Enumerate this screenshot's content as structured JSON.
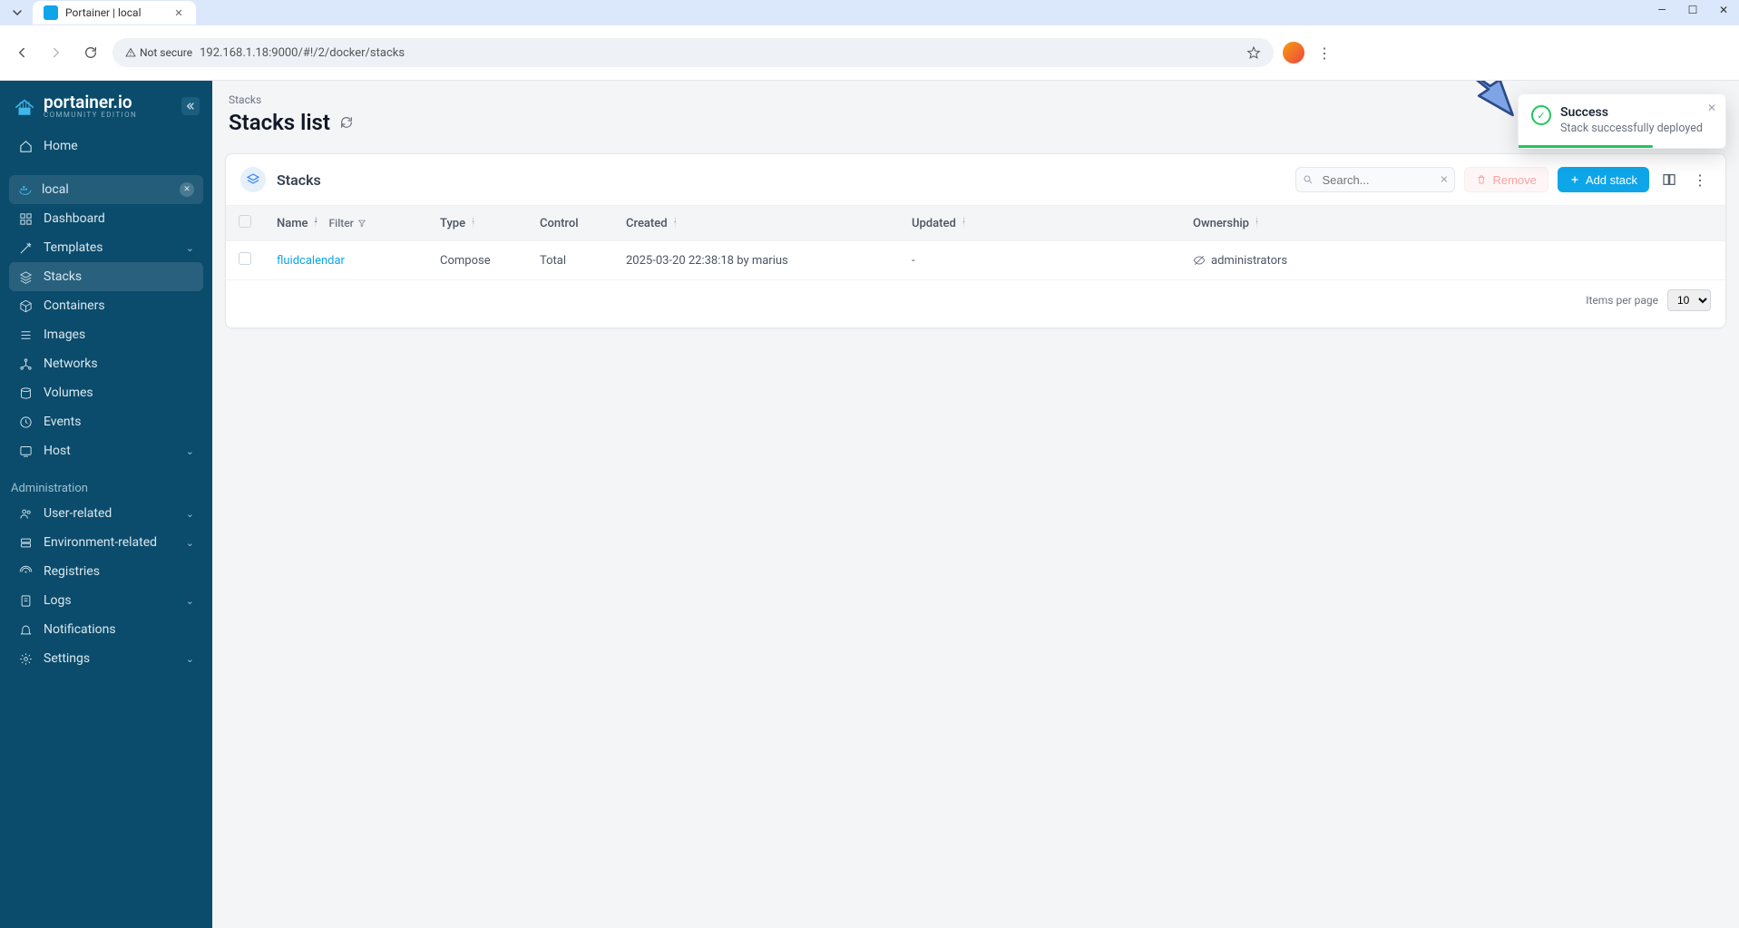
{
  "browser": {
    "tab_title": "Portainer | local",
    "not_secure_label": "Not secure",
    "url": "192.168.1.18:9000/#!/2/docker/stacks"
  },
  "logo": {
    "name": "portainer.io",
    "edition": "COMMUNITY EDITION"
  },
  "sidebar": {
    "home": "Home",
    "env_label": "local",
    "items": [
      {
        "label": "Dashboard"
      },
      {
        "label": "Templates",
        "expandable": true
      },
      {
        "label": "Stacks",
        "active": true
      },
      {
        "label": "Containers"
      },
      {
        "label": "Images"
      },
      {
        "label": "Networks"
      },
      {
        "label": "Volumes"
      },
      {
        "label": "Events"
      },
      {
        "label": "Host",
        "expandable": true
      }
    ],
    "admin_heading": "Administration",
    "admin_items": [
      {
        "label": "User-related",
        "expandable": true
      },
      {
        "label": "Environment-related",
        "expandable": true
      },
      {
        "label": "Registries"
      },
      {
        "label": "Logs",
        "expandable": true
      },
      {
        "label": "Notifications"
      },
      {
        "label": "Settings",
        "expandable": true
      }
    ]
  },
  "page": {
    "breadcrumb": "Stacks",
    "title": "Stacks list"
  },
  "panel": {
    "title": "Stacks",
    "search_placeholder": "Search...",
    "remove_label": "Remove",
    "add_label": "Add stack"
  },
  "table": {
    "columns": {
      "name": "Name",
      "filter": "Filter",
      "type": "Type",
      "control": "Control",
      "created": "Created",
      "updated": "Updated",
      "ownership": "Ownership"
    },
    "rows": [
      {
        "name": "fluidcalendar",
        "type": "Compose",
        "control": "Total",
        "created": "2025-03-20 22:38:18 by marius",
        "updated": "-",
        "ownership": "administrators"
      }
    ]
  },
  "pager": {
    "label": "Items per page",
    "value": "10"
  },
  "toast": {
    "title": "Success",
    "message": "Stack successfully deployed"
  }
}
